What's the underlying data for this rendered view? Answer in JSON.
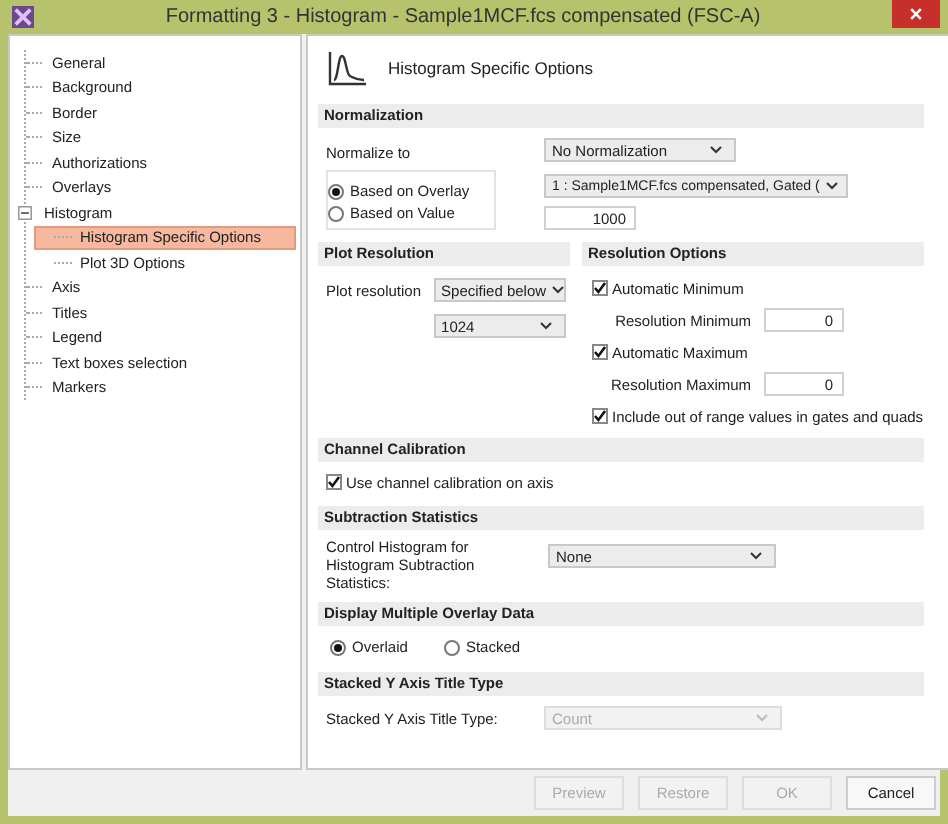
{
  "window": {
    "title": "Formatting 3 - Histogram - Sample1MCF.fcs compensated (FSC-A)"
  },
  "tree": [
    {
      "label": "General",
      "selected": false
    },
    {
      "label": "Background",
      "selected": false
    },
    {
      "label": "Border",
      "selected": false
    },
    {
      "label": "Size",
      "selected": false
    },
    {
      "label": "Authorizations",
      "selected": false
    },
    {
      "label": "Overlays",
      "selected": false
    },
    {
      "label": "Histogram",
      "selected": false,
      "expanded": true,
      "children": [
        {
          "label": "Histogram Specific Options",
          "selected": true
        },
        {
          "label": "Plot 3D Options",
          "selected": false
        }
      ]
    },
    {
      "label": "Axis",
      "selected": false
    },
    {
      "label": "Titles",
      "selected": false
    },
    {
      "label": "Legend",
      "selected": false
    },
    {
      "label": "Text boxes selection",
      "selected": false
    },
    {
      "label": "Markers",
      "selected": false
    }
  ],
  "page_title": "Histogram Specific Options",
  "normalization": {
    "heading": "Normalization",
    "label": "Normalize to",
    "mode": "No Normalization",
    "options": [
      {
        "label": "Based on Overlay",
        "selected": true
      },
      {
        "label": "Based on Value",
        "selected": false
      }
    ],
    "overlay": "1 : Sample1MCF.fcs compensated, Gated (",
    "value": "1000"
  },
  "plot_resolution": {
    "heading": "Plot Resolution",
    "label": "Plot resolution",
    "mode": "Specified below",
    "value": "1024"
  },
  "resolution_options": {
    "heading": "Resolution Options",
    "auto_min": {
      "label": "Automatic Minimum",
      "checked": true
    },
    "min_label": "Resolution Minimum",
    "min_value": "0",
    "auto_max": {
      "label": "Automatic Maximum",
      "checked": true
    },
    "max_label": "Resolution Maximum",
    "max_value": "0",
    "include": {
      "label": "Include out of range values in gates and quads",
      "checked": true
    }
  },
  "channel_calibration": {
    "heading": "Channel Calibration",
    "checkbox": {
      "label": "Use channel calibration on axis",
      "checked": true
    }
  },
  "subtraction": {
    "heading": "Subtraction Statistics",
    "label": "Control Histogram for Histogram Subtraction Statistics:",
    "value": "None"
  },
  "overlay_display": {
    "heading": "Display Multiple Overlay Data",
    "options": [
      {
        "label": "Overlaid",
        "selected": true
      },
      {
        "label": "Stacked",
        "selected": false
      }
    ]
  },
  "stacked_title": {
    "heading": "Stacked Y Axis Title Type",
    "label": "Stacked Y Axis Title Type:",
    "value": "Count",
    "disabled": true
  },
  "buttons": [
    {
      "label": "Preview",
      "disabled": true
    },
    {
      "label": "Restore",
      "disabled": true
    },
    {
      "label": "OK",
      "disabled": true
    },
    {
      "label": "Cancel",
      "disabled": false
    }
  ]
}
